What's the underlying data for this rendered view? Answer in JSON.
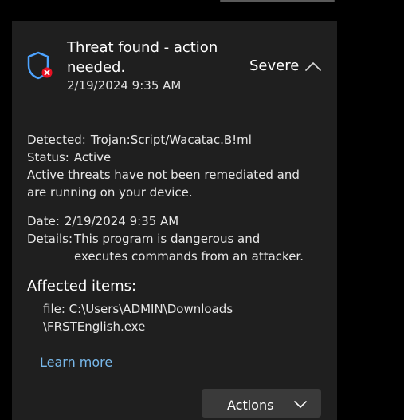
{
  "threat": {
    "title": "Threat found - action needed.",
    "timestamp": "2/19/2024 9:35 AM",
    "severity": "Severe",
    "detected_label": "Detected:",
    "detected_value": "Trojan:Script/Wacatac.B!ml",
    "status_label": "Status:",
    "status_value": "Active",
    "message": "Active threats have not been remediated and are running on your device.",
    "date_label": "Date:",
    "date_value": "2/19/2024 9:35 AM",
    "details_label": "Details:",
    "details_value": "This program is dangerous and executes commands from an attacker.",
    "affected_heading": "Affected items:",
    "affected_items": [
      {
        "line1": "file: C:\\Users\\ADMIN\\Downloads",
        "line2": "\\FRSTEnglish.exe"
      }
    ],
    "learn_more": "Learn more",
    "actions_label": "Actions"
  },
  "icons": {
    "shield": "shield-error-icon",
    "collapse": "chevron-up-icon",
    "actions_dropdown": "chevron-down-icon"
  },
  "colors": {
    "accent": "#4da3ff",
    "error": "#e81123",
    "link": "#78b8ea",
    "card_background": "#1f1f1f"
  }
}
